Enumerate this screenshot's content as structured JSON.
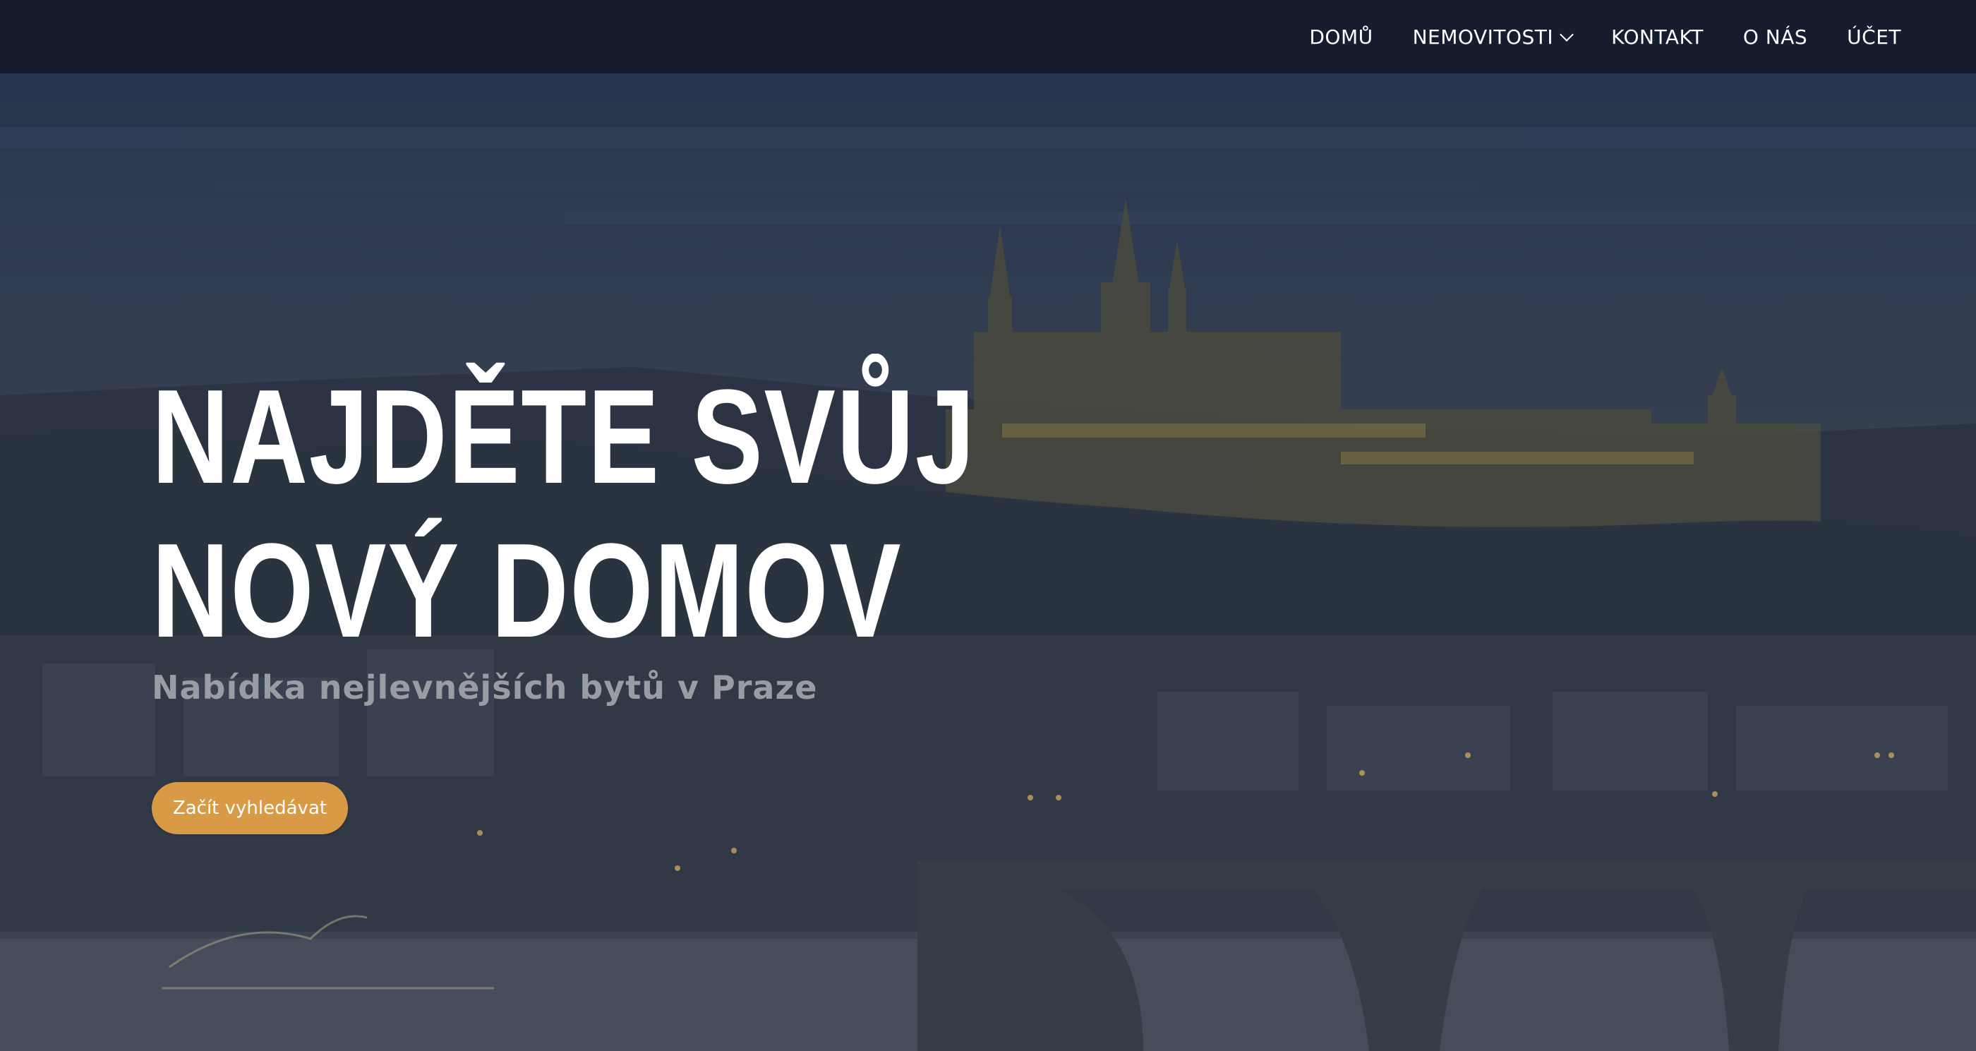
{
  "nav": {
    "items": [
      {
        "label": "DOMŮ",
        "has_dropdown": false
      },
      {
        "label": "NEMOVITOSTI",
        "has_dropdown": true
      },
      {
        "label": "KONTAKT",
        "has_dropdown": false
      },
      {
        "label": "O NÁS",
        "has_dropdown": false
      },
      {
        "label": "ÚČET",
        "has_dropdown": false
      }
    ]
  },
  "hero": {
    "title_line1": "NAJDĚTE SVŮJ",
    "title_line2": "NOVÝ DOMOV",
    "subtitle": "Nabídka nejlevnějších bytů v Praze",
    "cta_label": "Začít vyhledávat"
  },
  "colors": {
    "navbar_bg": "#161d2e",
    "accent": "#d99a45",
    "title_text": "#ffffff",
    "subtitle_text": "#9a9ca3"
  },
  "icons": {
    "dropdown": "chevron-down-icon"
  }
}
